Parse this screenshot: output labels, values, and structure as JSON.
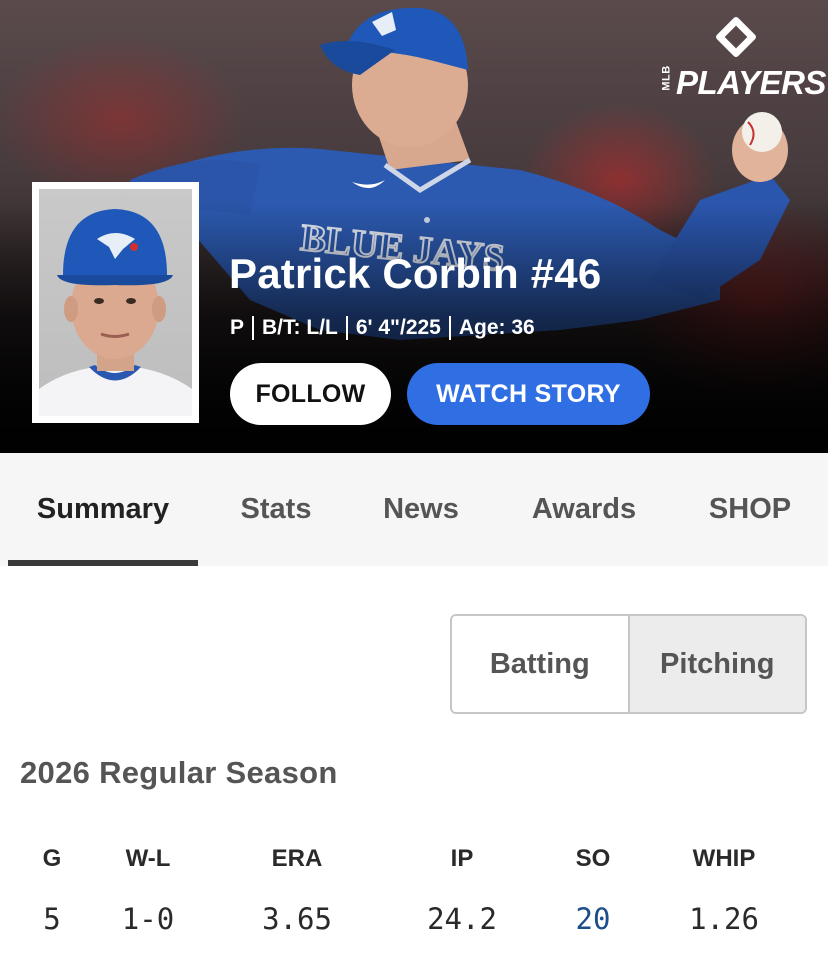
{
  "brand": {
    "logo_text": "PLAYERS",
    "logo_small": "MLB"
  },
  "player": {
    "name": "Patrick Corbin #46",
    "position": "P",
    "bats_throws": "B/T: L/L",
    "height_weight": "6' 4\"/225",
    "age": "Age: 36"
  },
  "actions": {
    "follow_label": "FOLLOW",
    "watch_story_label": "WATCH STORY"
  },
  "tabs": [
    {
      "label": "Summary",
      "active": true
    },
    {
      "label": "Stats"
    },
    {
      "label": "News"
    },
    {
      "label": "Awards"
    },
    {
      "label": "SHOP"
    }
  ],
  "segment": {
    "options": [
      "Batting",
      "Pitching"
    ],
    "selected": "Pitching"
  },
  "season": {
    "title": "2026 Regular Season",
    "headers": [
      "G",
      "W-L",
      "ERA",
      "IP",
      "SO",
      "WHIP"
    ],
    "values": [
      "5",
      "1-0",
      "3.65",
      "24.2",
      "20",
      "1.26"
    ],
    "link_color": "#1c4e8a"
  },
  "colors": {
    "accent": "#2f6fe3",
    "cap_blue": "#1f58b8",
    "jersey_blue": "#2c5ab0"
  },
  "icons": {
    "brand_logo": "mlb-players-diamond-icon"
  }
}
